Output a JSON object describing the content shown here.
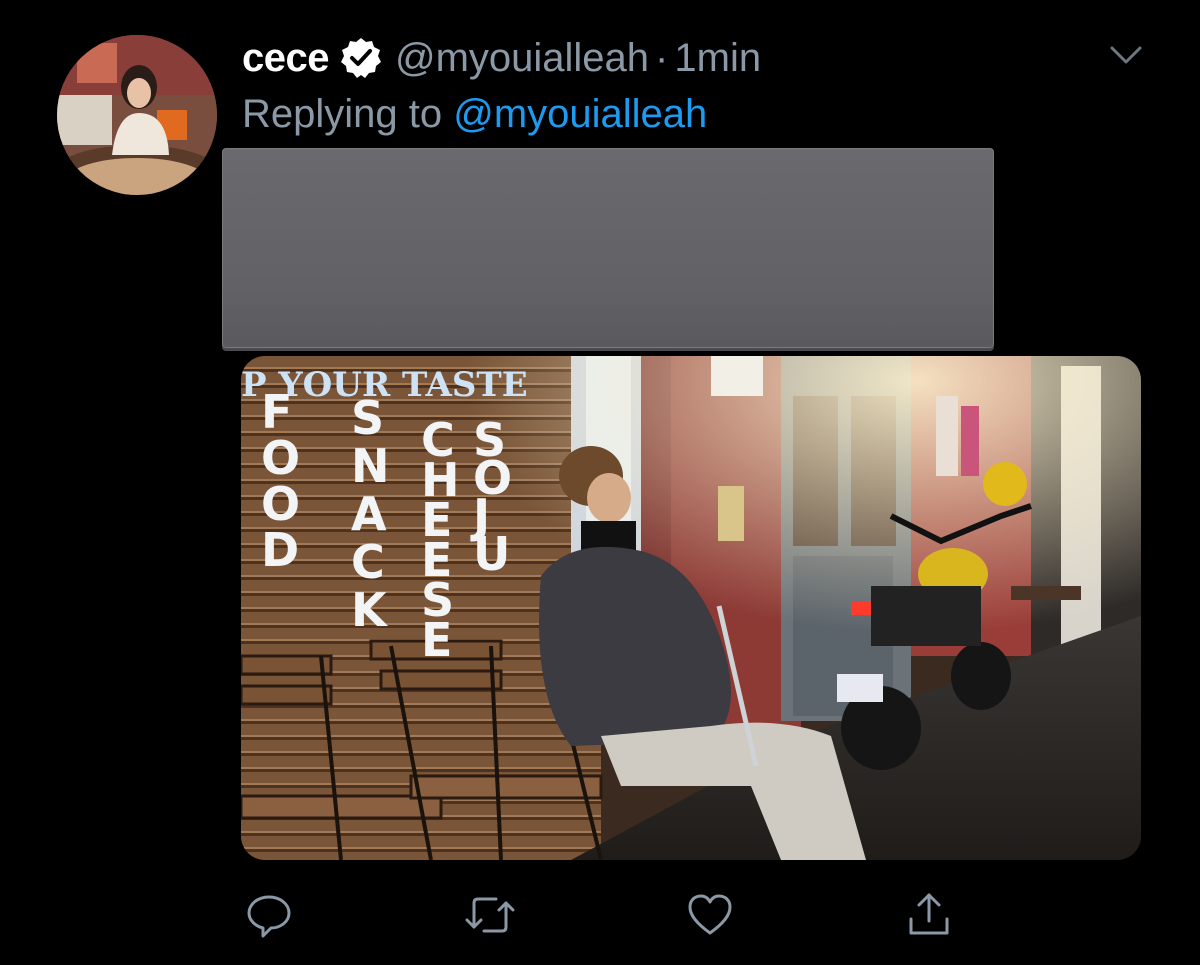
{
  "tweet": {
    "display_name": "cece",
    "handle": "@myouialleah",
    "separator": "·",
    "time": "1min",
    "reply_prefix": "Replying to ",
    "reply_mention": "@myouialleah"
  },
  "media_sign": {
    "header": "P YOUR TASTE",
    "col1": [
      "F",
      "O",
      "O",
      "D"
    ],
    "col2": [
      "S",
      "N",
      "A",
      "C",
      "K"
    ],
    "col3": [
      "C",
      "H",
      "E",
      "E",
      "S",
      "E"
    ],
    "col4": [
      "S",
      "O",
      "J",
      "U"
    ]
  },
  "icons": {
    "verified": "verified-badge-icon",
    "chevron": "chevron-down-icon",
    "reply": "reply-icon",
    "retweet": "retweet-icon",
    "like": "heart-icon",
    "share": "share-icon"
  },
  "colors": {
    "background": "#000000",
    "accent": "#1d9bf0",
    "secondary_text": "#8b98a5",
    "redaction": "#636367"
  }
}
